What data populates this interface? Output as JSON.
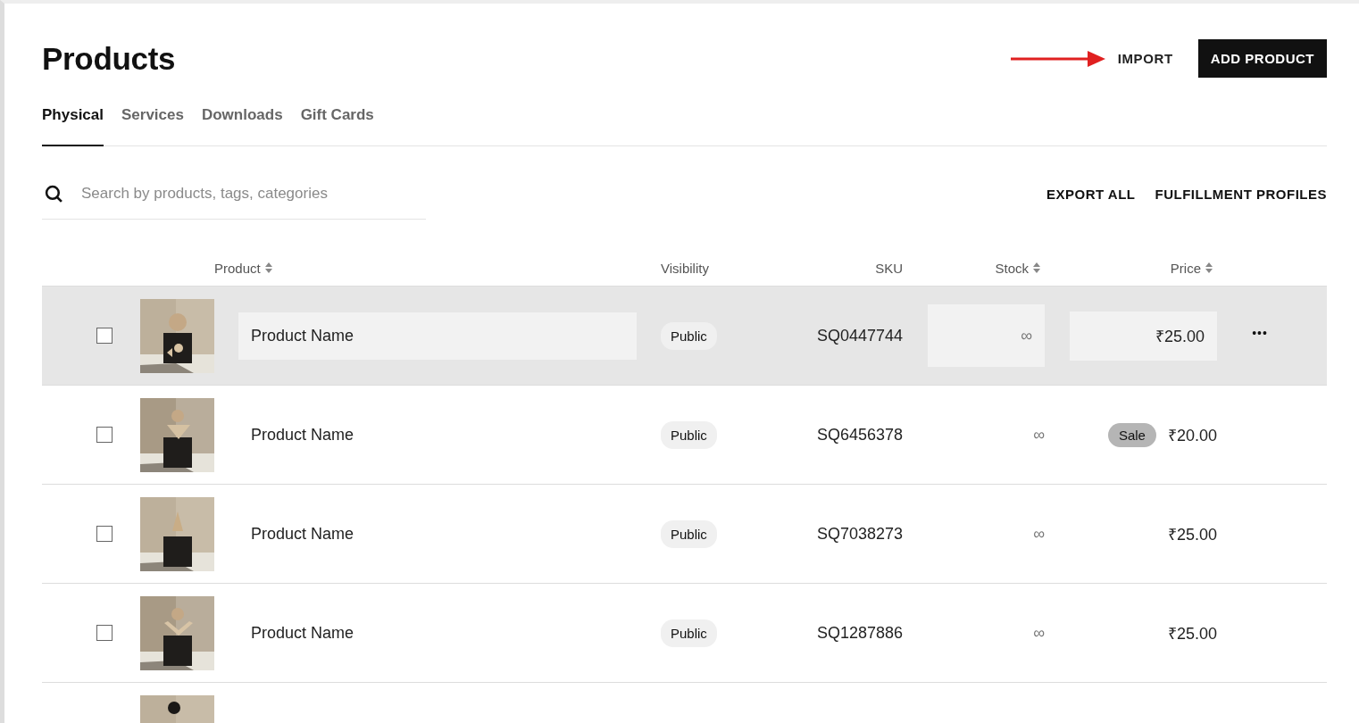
{
  "title": "Products",
  "actions": {
    "import": "IMPORT",
    "add": "ADD PRODUCT"
  },
  "tabs": [
    {
      "label": "Physical",
      "selected": true
    },
    {
      "label": "Services",
      "selected": false
    },
    {
      "label": "Downloads",
      "selected": false
    },
    {
      "label": "Gift Cards",
      "selected": false
    }
  ],
  "search": {
    "placeholder": "Search by products, tags, categories"
  },
  "links": [
    "EXPORT ALL",
    "FULFILLMENT PROFILES"
  ],
  "table": {
    "columns": [
      {
        "label": "Product",
        "sortable": true
      },
      {
        "label": "Visibility",
        "sortable": false
      },
      {
        "label": "SKU",
        "sortable": false
      },
      {
        "label": "Stock",
        "sortable": true
      },
      {
        "label": "Price",
        "sortable": true
      }
    ],
    "rows": [
      {
        "kind": "product",
        "highlighted": true,
        "checked": false,
        "name": "Product Name",
        "visibility": "Public",
        "sku": "SQ0447744",
        "stock": "∞",
        "price": "₹25.00",
        "more": "•••"
      },
      {
        "kind": "product",
        "highlighted": false,
        "checked": false,
        "name": "Product Name",
        "visibility": "Public",
        "sku": "SQ6456378",
        "stock": "∞",
        "badge": "Sale",
        "price": "₹20.00"
      },
      {
        "kind": "product",
        "highlighted": false,
        "checked": false,
        "name": "Product Name",
        "visibility": "Public",
        "sku": "SQ7038273",
        "stock": "∞",
        "price": "₹25.00"
      },
      {
        "kind": "product",
        "highlighted": false,
        "checked": false,
        "name": "Product Name",
        "visibility": "Public",
        "sku": "SQ1287886",
        "stock": "∞",
        "price": "₹25.00"
      },
      {
        "kind": "cut_off"
      }
    ]
  }
}
